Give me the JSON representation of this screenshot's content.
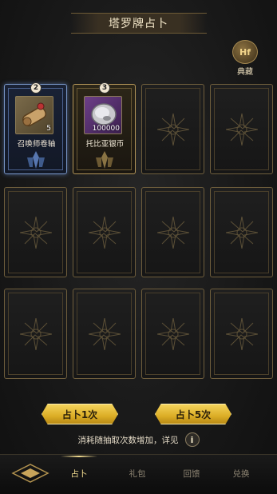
{
  "header": {
    "title": "塔罗牌占卜"
  },
  "collection": {
    "label": "典藏",
    "icon_name": "tarot-collection-icon",
    "icon_text": "Hf"
  },
  "cards": [
    {
      "state": "revealed-blue",
      "count": "2",
      "item_icon": "summon-scroll-icon",
      "quantity": "5",
      "name": "召唤师卷轴"
    },
    {
      "state": "revealed-gold",
      "count": "3",
      "item_icon": "silver-coin-icon",
      "quantity": "100000",
      "name": "托比亚银币"
    },
    {
      "state": "face-down"
    },
    {
      "state": "face-down"
    },
    {
      "state": "face-down"
    },
    {
      "state": "face-down"
    },
    {
      "state": "face-down"
    },
    {
      "state": "face-down"
    },
    {
      "state": "face-down"
    },
    {
      "state": "face-down"
    },
    {
      "state": "face-down"
    },
    {
      "state": "face-down"
    }
  ],
  "actions": {
    "draw_one": "占卜1次",
    "draw_five": "占卜5次"
  },
  "note": {
    "text": "消耗随抽取次数增加，详见",
    "info_icon": "i"
  },
  "nav": {
    "tabs": [
      "占卜",
      "礼包",
      "回馈",
      "兑换"
    ],
    "active_index": 0
  },
  "colors": {
    "gold_button": "#e2b534",
    "active_tab": "#f3dc90",
    "card_border": "#6f5e3c"
  }
}
